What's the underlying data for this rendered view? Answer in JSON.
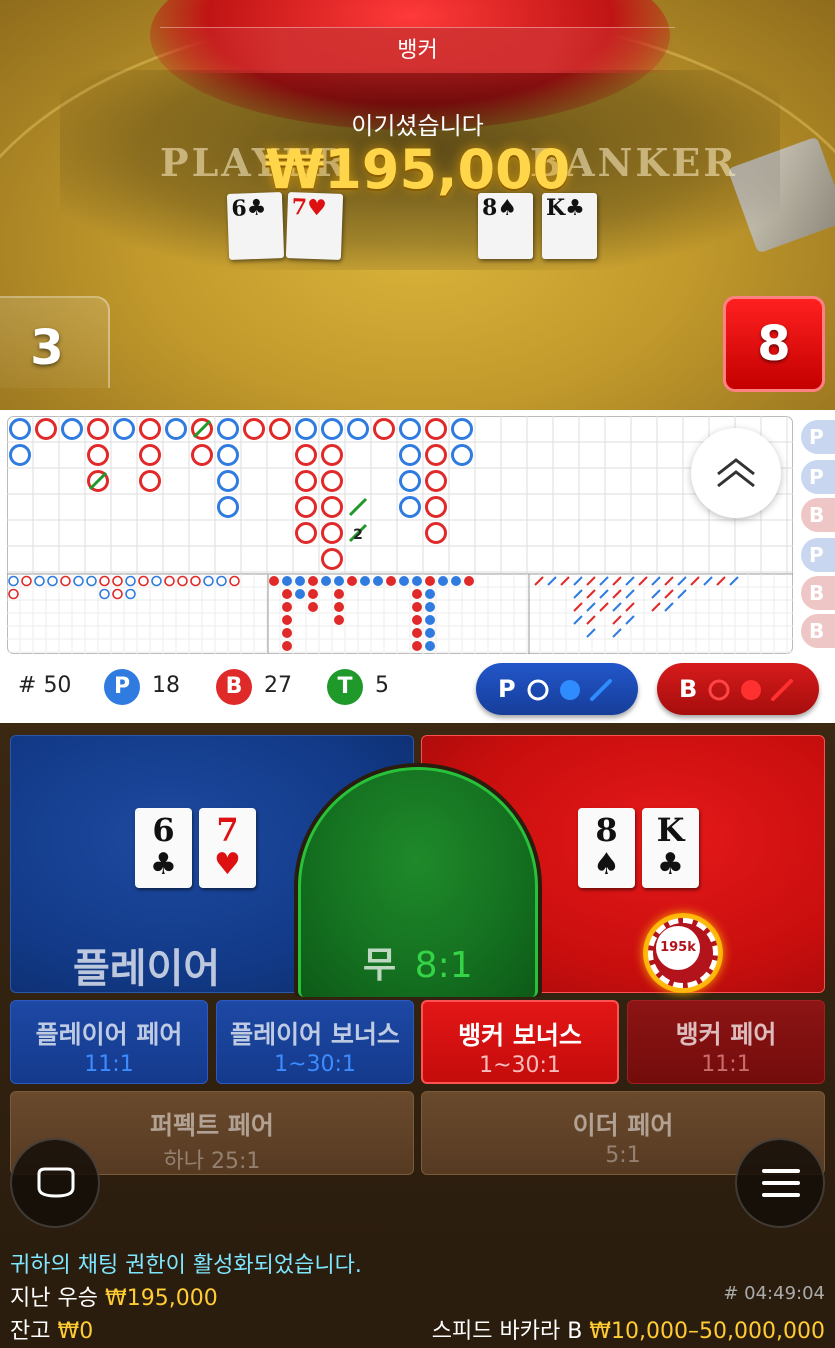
{
  "video": {
    "winner_banner": "뱅커",
    "win_message": "이기셨습니다",
    "win_amount": "₩195,000",
    "felt_left": "PLAYER",
    "felt_right": "BANKER",
    "player_score": "3",
    "banker_score": "8",
    "player_cards": [
      {
        "rank": "6",
        "suit": "♣",
        "color": "black"
      },
      {
        "rank": "7",
        "suit": "♥",
        "color": "red"
      }
    ],
    "banker_cards": [
      {
        "rank": "8",
        "suit": "♠",
        "color": "black"
      },
      {
        "rank": "K",
        "suit": "♣",
        "color": "black"
      }
    ]
  },
  "roadmap": {
    "side_predictions": [
      "P",
      "P",
      "B",
      "P",
      "B",
      "B"
    ],
    "big_road_tie_count_label": "2",
    "colors": {
      "player": "#2f7be0",
      "banker": "#e02a2a",
      "tie": "#1f9a2a"
    }
  },
  "stats": {
    "rounds_prefix": "#",
    "rounds": "50",
    "player_badge": "P",
    "player_count": "18",
    "banker_badge": "B",
    "banker_count": "27",
    "tie_badge": "T",
    "tie_count": "5",
    "ask_player_label": "P",
    "ask_banker_label": "B"
  },
  "betting": {
    "player_label": "플레이어",
    "tie_label": "무",
    "tie_odds": "8:1",
    "banker_chip": "195k",
    "side_bets": [
      {
        "title": "플레이어 페어",
        "odds": "11:1"
      },
      {
        "title": "플레이어 보너스",
        "odds": "1~30:1"
      },
      {
        "title": "뱅커 보너스",
        "odds": "1~30:1"
      },
      {
        "title": "뱅커 페어",
        "odds": "11:1"
      },
      {
        "title": "퍼펙트 페어",
        "odds": "하나 25:1"
      },
      {
        "title": "이더 페어",
        "odds": "5:1"
      }
    ]
  },
  "footer": {
    "chat_notice": "귀하의 채팅 권한이 활성화되었습니다.",
    "last_win_label": "지난 우승",
    "last_win_value": "₩195,000",
    "balance_label": "잔고",
    "balance_value": "₩0",
    "round_id": "# 04:49:04",
    "table_name": "스피드 바카라 B",
    "bet_limits": "₩10,000–50,000,000"
  }
}
